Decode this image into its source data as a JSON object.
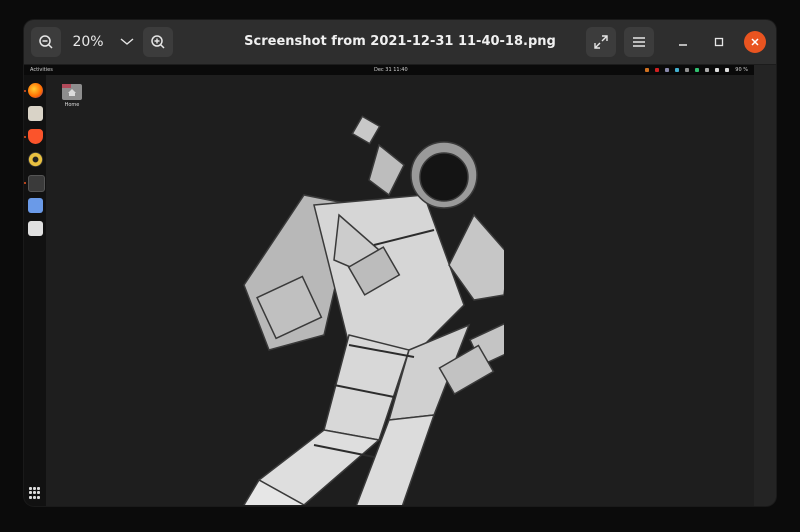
{
  "window": {
    "title": "Screenshot from 2021-12-31 11-40-18.png",
    "zoom_label": "20%",
    "accent_close": "#e95420"
  },
  "toolbar": {
    "zoom_out_icon": "zoom-out-icon",
    "zoom_in_icon": "zoom-in-icon",
    "dropdown_icon": "chevron-down-icon",
    "fullscreen_icon": "fullscreen-icon",
    "menu_icon": "hamburger-menu-icon"
  },
  "screenshot": {
    "topbar": {
      "activities": "Activities",
      "clock": "Dec 31  11:40",
      "battery": "90 %"
    },
    "desktop": {
      "home_label": "Home"
    },
    "dock_apps": [
      "firefox",
      "files",
      "brave",
      "rhythmbox",
      "terminal",
      "screenshot",
      "trash"
    ]
  }
}
